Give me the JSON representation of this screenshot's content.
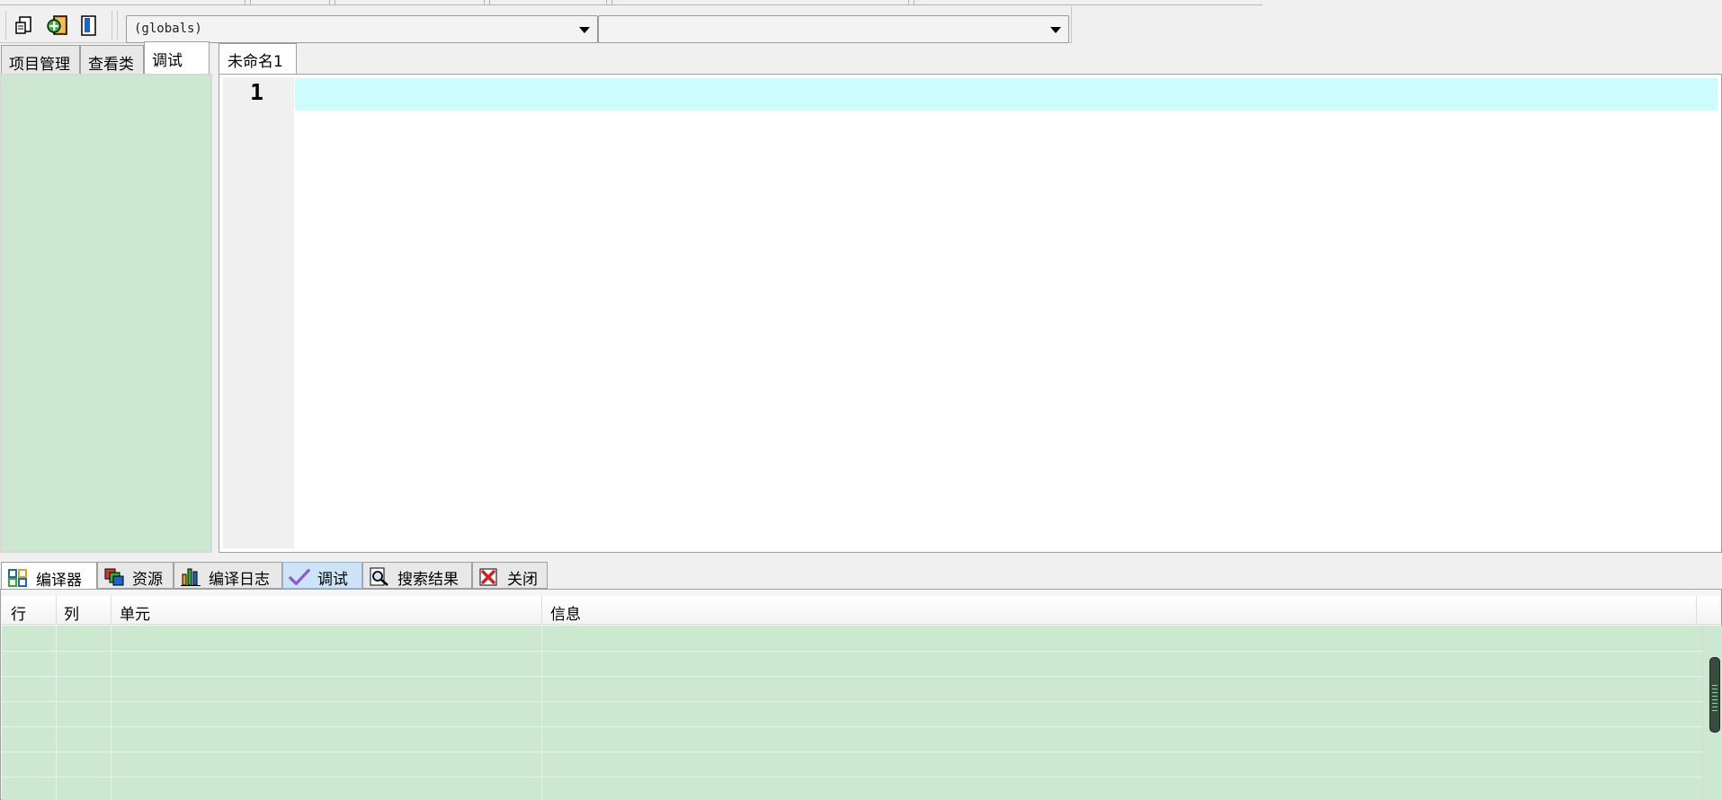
{
  "toolbar": {
    "buttons": [
      {
        "name": "new-file-icon"
      },
      {
        "name": "add-to-project-icon"
      },
      {
        "name": "bookmark-icon"
      }
    ],
    "scope_combo": {
      "value": "(globals)"
    },
    "member_combo": {
      "value": ""
    }
  },
  "left_panel": {
    "tabs": [
      {
        "label": "项目管理"
      },
      {
        "label": "查看类"
      },
      {
        "label": "调试",
        "active": true
      }
    ]
  },
  "editor": {
    "tabs": [
      {
        "label": "未命名1",
        "active": true
      }
    ],
    "line_numbers": [
      "1"
    ],
    "content": ""
  },
  "bottom_panel": {
    "tabs": [
      {
        "label": "编译器",
        "icon": "compiler-grid-icon",
        "active": true
      },
      {
        "label": "资源",
        "icon": "resources-icon"
      },
      {
        "label": "编译日志",
        "icon": "compile-log-chart-icon"
      },
      {
        "label": "调试",
        "icon": "debug-check-icon",
        "highlighted": true
      },
      {
        "label": "搜索结果",
        "icon": "search-magnifier-icon"
      },
      {
        "label": "关闭",
        "icon": "close-x-icon"
      }
    ],
    "table": {
      "columns": [
        "行",
        "列",
        "单元",
        "信息"
      ],
      "rows": []
    }
  },
  "colors": {
    "panel_green": "#cde8d0",
    "current_line": "#ccfcfc",
    "highlight_tab": "#cde3f8"
  }
}
